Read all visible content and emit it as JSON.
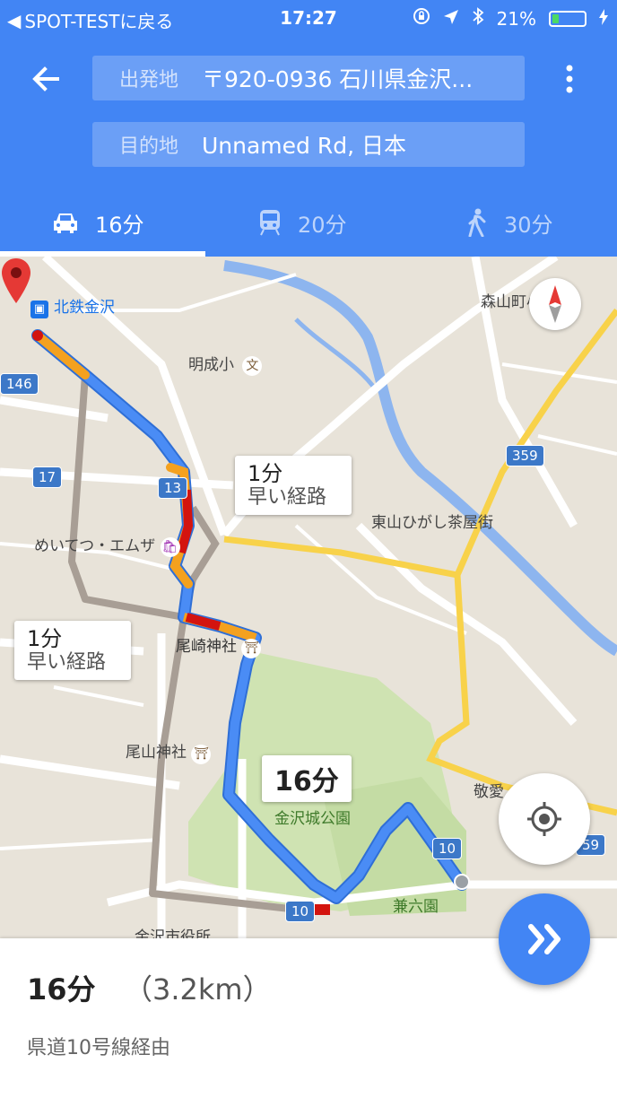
{
  "status_bar": {
    "back_app": "SPOT-TESTに戻る",
    "time": "17:27",
    "battery": "21%",
    "battery_level": 0.21
  },
  "header": {
    "origin_label": "出発地",
    "origin_value": "〒920-0936 石川県金沢...",
    "destination_label": "目的地",
    "destination_value": "Unnamed Rd, 日本"
  },
  "modes": [
    {
      "icon": "car-icon",
      "label": "16分",
      "selected": true
    },
    {
      "icon": "train-icon",
      "label": "20分",
      "selected": false
    },
    {
      "icon": "walk-icon",
      "label": "30分",
      "selected": false
    }
  ],
  "map": {
    "labels": {
      "kitetsu": "北鉄金沢",
      "meisei": "明成小",
      "moriyama": "森山町小",
      "higashi": "東山ひがし茶屋街",
      "meitetsu": "めいてつ・エムザ",
      "ozaki": "尾崎神社",
      "oyama": "尾山神社",
      "castle_park": "金沢城公園",
      "kenrokuen": "兼六園",
      "keiai": "敬愛",
      "city_hall": "金沢市役所",
      "school_glyph": "文",
      "shrine_glyph": "⛩"
    },
    "shields": {
      "r146": "146",
      "r17": "17",
      "r13": "13",
      "r359": "359",
      "r359b": "59",
      "r10a": "10",
      "r10b": "10"
    },
    "callouts": {
      "alt_right_time": "1分",
      "alt_right_text": "早い経路",
      "alt_left_time": "1分",
      "alt_left_text": "早い経路",
      "main_time": "16分"
    }
  },
  "summary": {
    "duration": "16分",
    "distance": "（3.2km）",
    "via": "県道10号線経由"
  },
  "colors": {
    "header_blue": "#4285f4",
    "route_blue": "#4a89f3",
    "alt_route_gray": "#a89e95",
    "traffic_orange": "#f4a11f",
    "traffic_red": "#d3140f",
    "river_blue": "#89b4f0",
    "park_green": "#c8dfa9"
  }
}
